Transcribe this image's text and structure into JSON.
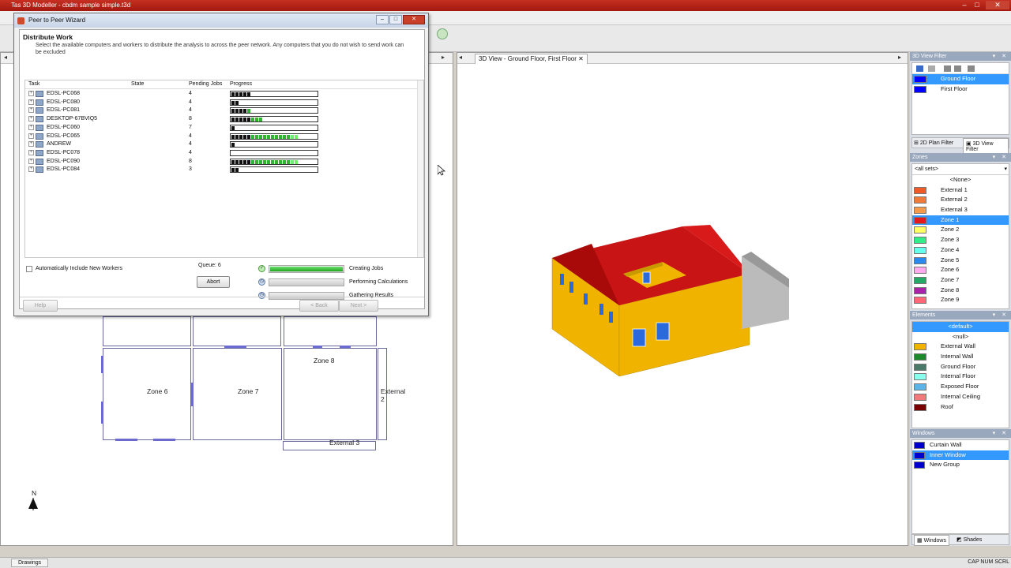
{
  "app": {
    "title": "Tas 3D Modeller - cbdm sample simple.t3d"
  },
  "dialog": {
    "title": "Peer to Peer Wizard",
    "heading": "Distribute Work",
    "description": "Select the available computers and workers to distribute the analysis to across the peer network. Any computers that you do not wish to send work can be excluded",
    "columns": {
      "task": "Task",
      "state": "State",
      "pending": "Pending Jobs",
      "progress": "Progress"
    },
    "rows": [
      {
        "name": "EDSL-PC068",
        "pending": "4",
        "black": 5,
        "green": 0
      },
      {
        "name": "EDSL-PC080",
        "pending": "4",
        "black": 2,
        "green": 0
      },
      {
        "name": "EDSL-PC081",
        "pending": "4",
        "black": 4,
        "green": 1
      },
      {
        "name": "DESKTOP-67BVIQ5",
        "pending": "8",
        "black": 5,
        "green": 3
      },
      {
        "name": "EDSL-PC060",
        "pending": "7",
        "black": 1,
        "green": 0
      },
      {
        "name": "EDSL-PC065",
        "pending": "4",
        "black": 5,
        "green": 12
      },
      {
        "name": "ANDREW",
        "pending": "4",
        "black": 1,
        "green": 0
      },
      {
        "name": "EDSL-PC078",
        "pending": "4",
        "black": 0,
        "green": 0
      },
      {
        "name": "EDSL-PC090",
        "pending": "8",
        "black": 5,
        "green": 12
      },
      {
        "name": "EDSL-PC084",
        "pending": "3",
        "black": 2,
        "green": 0
      }
    ],
    "auto_include_label": "Automatically Include New Workers",
    "queue_label": "Queue: 6",
    "abort_label": "Abort",
    "stages": [
      {
        "label": "Creating Jobs",
        "progress": 1.0
      },
      {
        "label": "Performing Calculations",
        "progress": 0
      },
      {
        "label": "Gathering Results",
        "progress": 0
      }
    ],
    "help_label": "Help",
    "back_label": "< Back",
    "next_label": "Next >"
  },
  "view3d": {
    "tab_label": "3D View - Ground Floor, First Floor"
  },
  "floorplan": {
    "rooms": [
      "Zone 6",
      "Zone 7",
      "Zone 8",
      "External 2",
      "External 3"
    ],
    "north_label": "N"
  },
  "filter3d": {
    "header": "3D View Filter",
    "items": [
      {
        "label": "Ground Floor",
        "selected": true,
        "color": "#0000ff"
      },
      {
        "label": "First Floor",
        "selected": false,
        "color": "#0000ff"
      }
    ],
    "tabs": [
      "2D Plan Filter",
      "3D View Filter"
    ]
  },
  "zones": {
    "header": "Zones",
    "select_value": "all sets",
    "items": [
      {
        "label": "<None>",
        "color": "",
        "selected": false
      },
      {
        "label": "External 1",
        "color": "#f05a28",
        "selected": false
      },
      {
        "label": "External 2",
        "color": "#f07a3a",
        "selected": false
      },
      {
        "label": "External 3",
        "color": "#f49a4a",
        "selected": false
      },
      {
        "label": "Zone 1",
        "color": "#e31a1c",
        "selected": true
      },
      {
        "label": "Zone 2",
        "color": "#ffff66",
        "selected": false
      },
      {
        "label": "Zone 3",
        "color": "#33ee88",
        "selected": false
      },
      {
        "label": "Zone 4",
        "color": "#66ffee",
        "selected": false
      },
      {
        "label": "Zone 5",
        "color": "#2a88ee",
        "selected": false
      },
      {
        "label": "Zone 6",
        "color": "#ffaaee",
        "selected": false
      },
      {
        "label": "Zone 7",
        "color": "#22aa66",
        "selected": false
      },
      {
        "label": "Zone 8",
        "color": "#aa22aa",
        "selected": false
      },
      {
        "label": "Zone 9",
        "color": "#ff6677",
        "selected": false
      }
    ]
  },
  "elements": {
    "header": "Elements",
    "items": [
      {
        "label": "<default>",
        "color": "",
        "selected": true
      },
      {
        "label": "<null>",
        "color": "",
        "selected": false
      },
      {
        "label": "External Wall",
        "color": "#f0b400",
        "selected": false
      },
      {
        "label": "Internal Wall",
        "color": "#1c8a2a",
        "selected": false
      },
      {
        "label": "Ground Floor",
        "color": "#4a7a6a",
        "selected": false
      },
      {
        "label": "Internal Floor",
        "color": "#88ffee",
        "selected": false
      },
      {
        "label": "Exposed Floor",
        "color": "#5ab4e8",
        "selected": false
      },
      {
        "label": "Internal Ceiling",
        "color": "#f07a7a",
        "selected": false
      },
      {
        "label": "Roof",
        "color": "#7a0000",
        "selected": false
      }
    ]
  },
  "windows": {
    "header": "Windows",
    "items": [
      {
        "label": "Curtain Wall",
        "selected": false
      },
      {
        "label": "Inner Window",
        "selected": true
      },
      {
        "label": "New Group",
        "selected": false
      }
    ],
    "tabs": [
      "Windows",
      "Shades"
    ]
  },
  "statusbar": {
    "tab": "Drawings",
    "indicators": "CAP  NUM  SCRL"
  }
}
